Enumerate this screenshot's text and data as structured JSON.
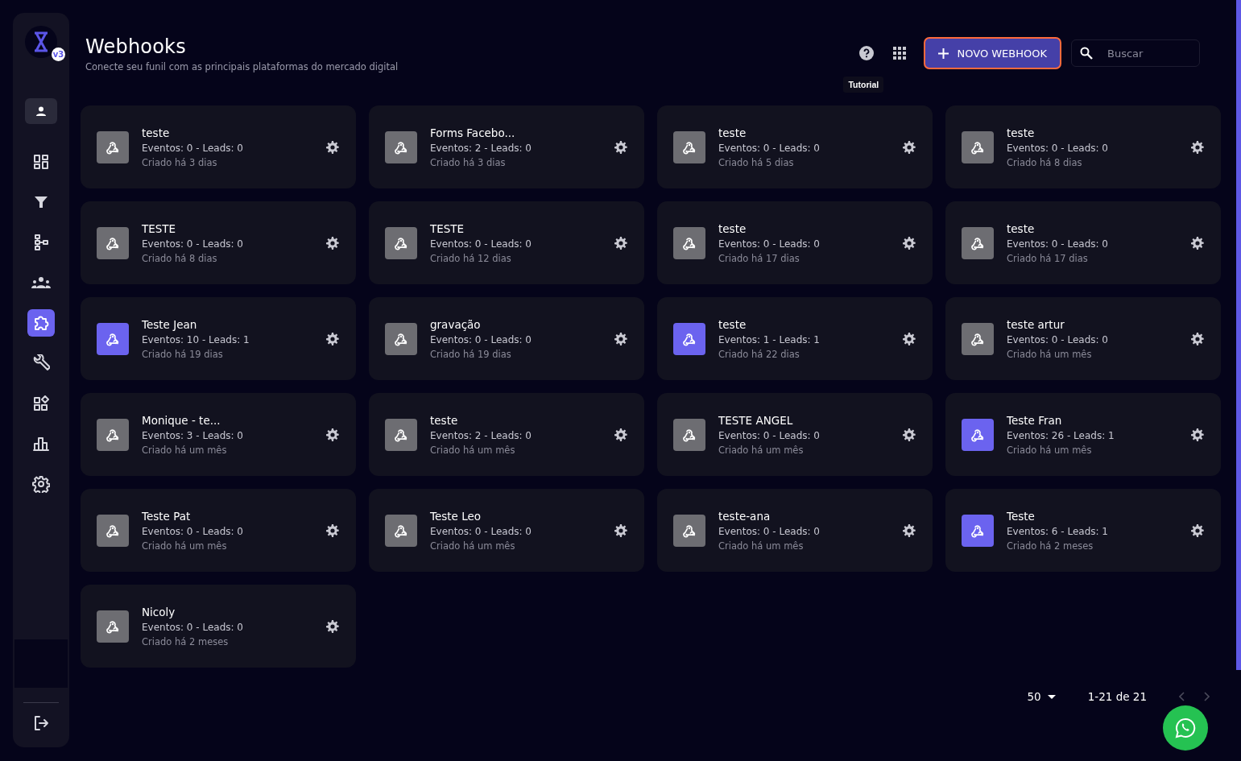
{
  "sidebar": {
    "badge": "v3",
    "items": [
      {
        "kind": "profile",
        "selected": false
      },
      {
        "kind": "dashboard",
        "selected": false
      },
      {
        "kind": "funnel",
        "selected": false
      },
      {
        "kind": "flow",
        "selected": false
      },
      {
        "kind": "team",
        "selected": false
      },
      {
        "kind": "puzzle",
        "selected": true
      },
      {
        "kind": "wrench",
        "selected": false
      },
      {
        "kind": "apps",
        "selected": false
      },
      {
        "kind": "chart",
        "selected": false
      },
      {
        "kind": "settings",
        "selected": false
      }
    ]
  },
  "header": {
    "title": "Webhooks",
    "subtitle": "Conecte seu funil com as principais plataformas do mercado digital",
    "tooltip": "Tutorial",
    "new_button": "NOVO WEBHOOK",
    "search": {
      "placeholder": "Buscar"
    }
  },
  "webhooks": [
    {
      "name": "teste",
      "stats": "Eventos: 0 - Leads: 0",
      "created": "Criado há 3 dias",
      "active": false
    },
    {
      "name": "Forms Facebo...",
      "stats": "Eventos: 2 - Leads: 0",
      "created": "Criado há 3 dias",
      "active": false
    },
    {
      "name": "teste",
      "stats": "Eventos: 0 - Leads: 0",
      "created": "Criado há 5 dias",
      "active": false
    },
    {
      "name": "teste",
      "stats": "Eventos: 0 - Leads: 0",
      "created": "Criado há 8 dias",
      "active": false
    },
    {
      "name": "TESTE",
      "stats": "Eventos: 0 - Leads: 0",
      "created": "Criado há 8 dias",
      "active": false
    },
    {
      "name": "TESTE",
      "stats": "Eventos: 0 - Leads: 0",
      "created": "Criado há 12 dias",
      "active": false
    },
    {
      "name": "teste",
      "stats": "Eventos: 0 - Leads: 0",
      "created": "Criado há 17 dias",
      "active": false
    },
    {
      "name": "teste",
      "stats": "Eventos: 0 - Leads: 0",
      "created": "Criado há 17 dias",
      "active": false
    },
    {
      "name": "Teste Jean",
      "stats": "Eventos: 10 - Leads: 1",
      "created": "Criado há 19 dias",
      "active": true
    },
    {
      "name": "gravação",
      "stats": "Eventos: 0 - Leads: 0",
      "created": "Criado há 19 dias",
      "active": false
    },
    {
      "name": "teste",
      "stats": "Eventos: 1 - Leads: 1",
      "created": "Criado há 22 dias",
      "active": true
    },
    {
      "name": "teste artur",
      "stats": "Eventos: 0 - Leads: 0",
      "created": "Criado há um mês",
      "active": false
    },
    {
      "name": "Monique - te...",
      "stats": "Eventos: 3 - Leads: 0",
      "created": "Criado há um mês",
      "active": false
    },
    {
      "name": "teste",
      "stats": "Eventos: 2 - Leads: 0",
      "created": "Criado há um mês",
      "active": false
    },
    {
      "name": "TESTE ANGEL",
      "stats": "Eventos: 0 - Leads: 0",
      "created": "Criado há um mês",
      "active": false
    },
    {
      "name": "Teste Fran",
      "stats": "Eventos: 26 - Leads: 1",
      "created": "Criado há um mês",
      "active": true
    },
    {
      "name": "Teste Pat",
      "stats": "Eventos: 0 - Leads: 0",
      "created": "Criado há um mês",
      "active": false
    },
    {
      "name": "Teste Leo",
      "stats": "Eventos: 0 - Leads: 0",
      "created": "Criado há um mês",
      "active": false
    },
    {
      "name": "teste-ana",
      "stats": "Eventos: 0 - Leads: 0",
      "created": "Criado há um mês",
      "active": false
    },
    {
      "name": "Teste",
      "stats": "Eventos: 6 - Leads: 1",
      "created": "Criado há 2 meses",
      "active": true
    },
    {
      "name": "Nicoly",
      "stats": "Eventos: 0 - Leads: 0",
      "created": "Criado há 2 meses",
      "active": false
    }
  ],
  "pagination": {
    "rows_per_page": "50",
    "range": "1-21 de 21"
  }
}
